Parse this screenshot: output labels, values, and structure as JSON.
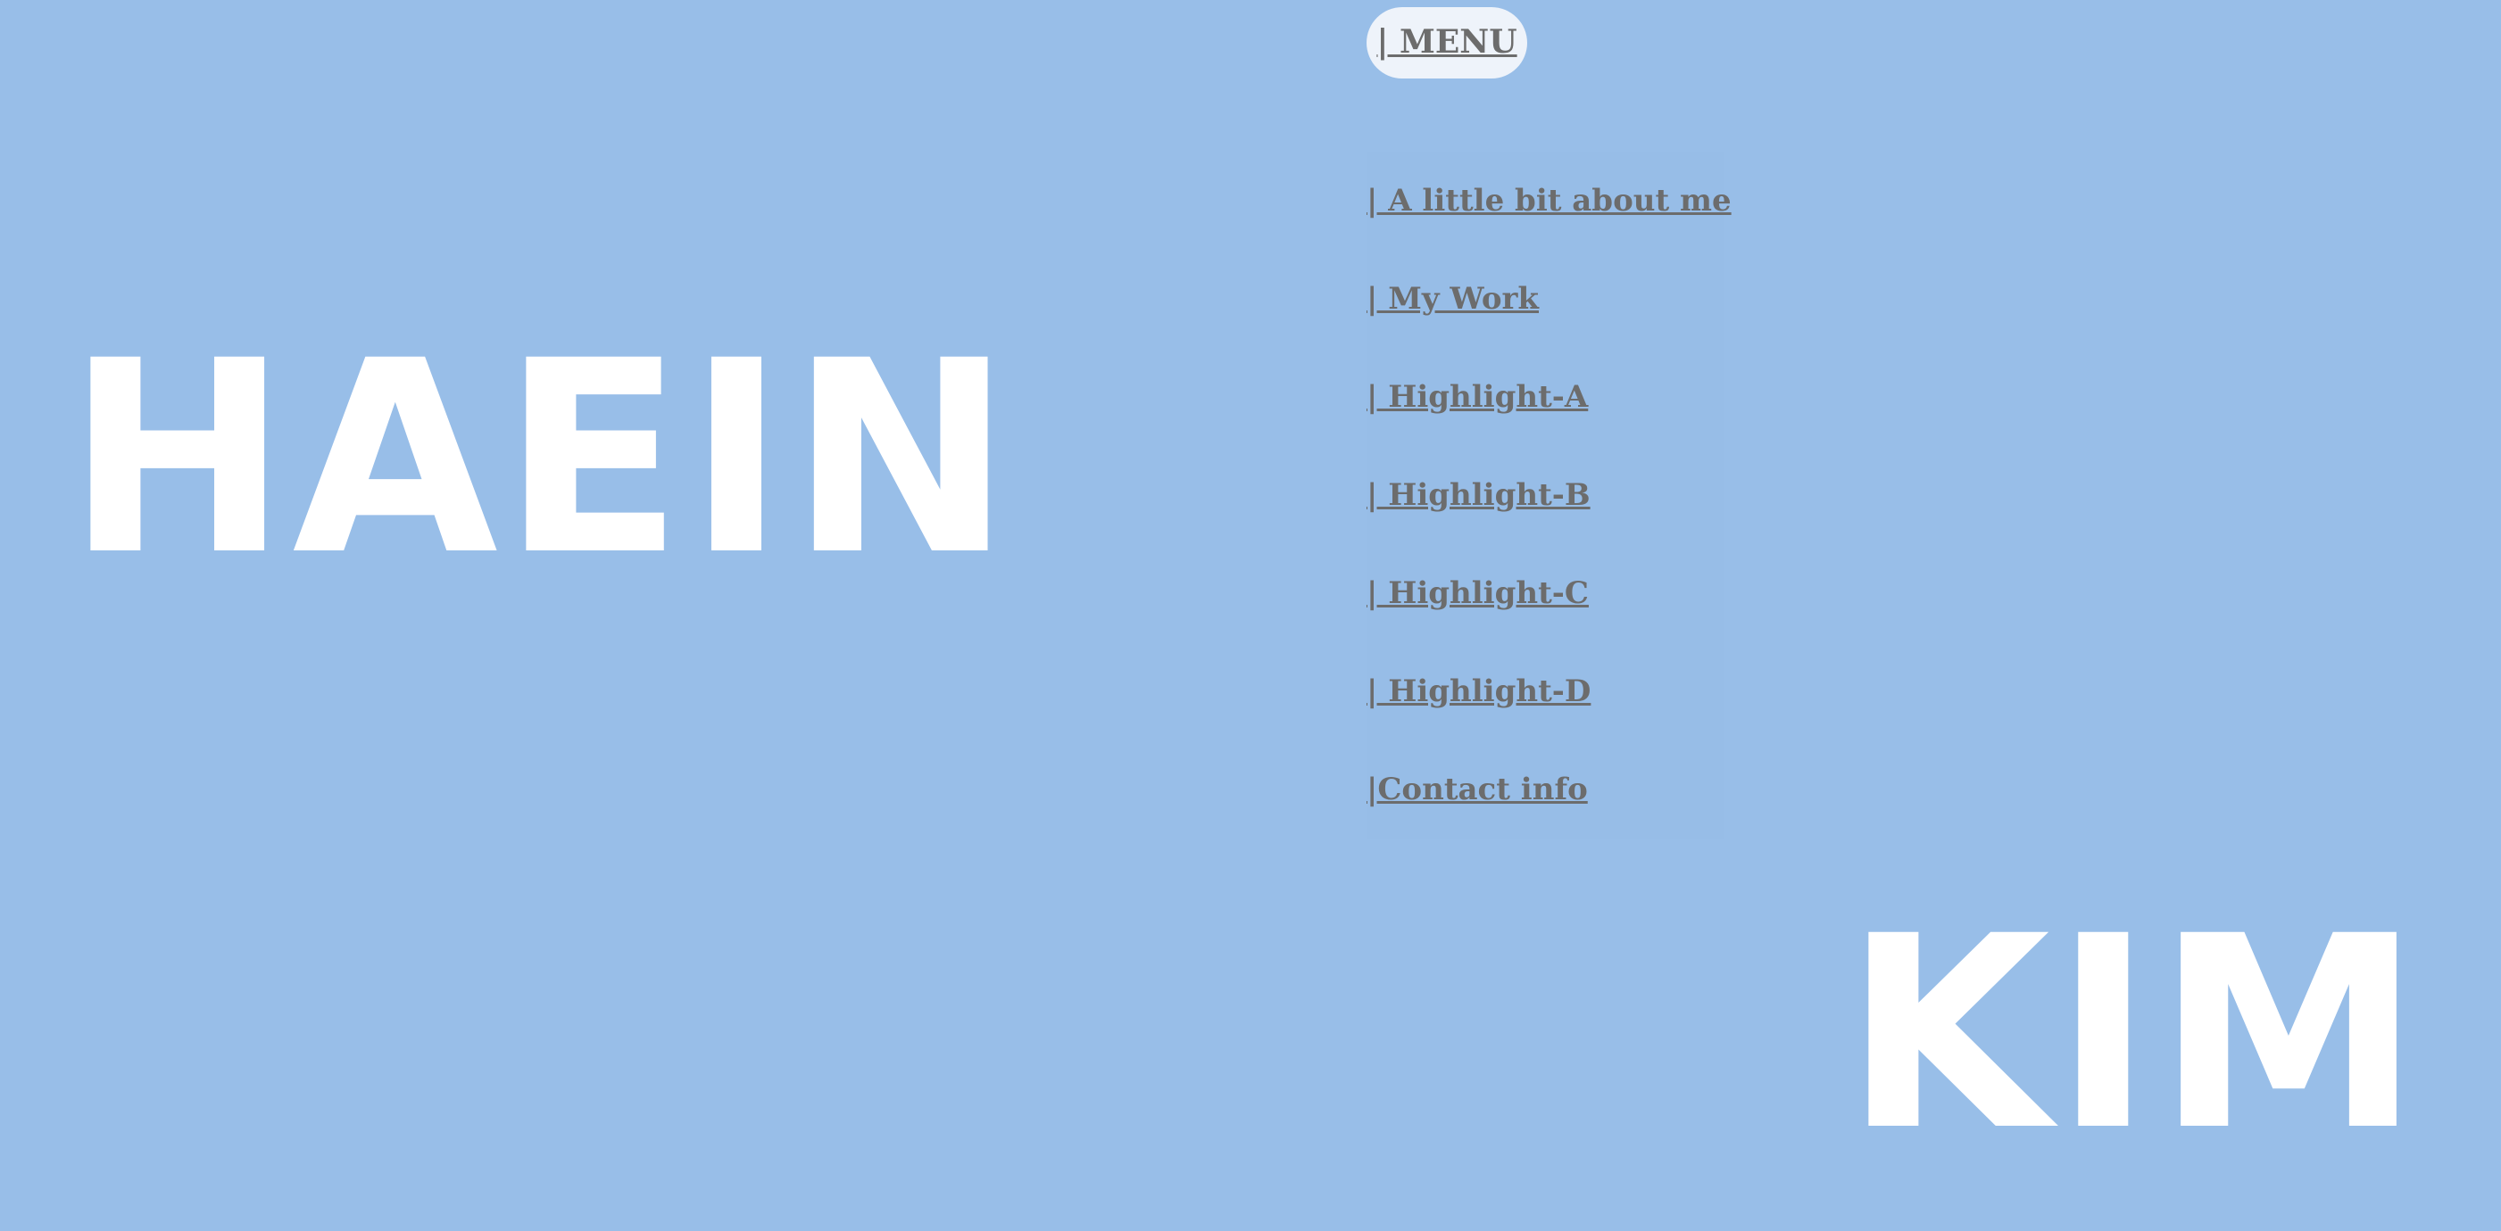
{
  "hero": {
    "first_name": "HAEIN",
    "last_name": "KIM"
  },
  "menu": {
    "button_label": "| MENU",
    "items": [
      {
        "label": "| A little bit about me"
      },
      {
        "label": "| My Work"
      },
      {
        "label": "| Highlight-A"
      },
      {
        "label": "| Highlight-B"
      },
      {
        "label": "| Highlight-C"
      },
      {
        "label": "| Highlight-D"
      },
      {
        "label": "|Contact info"
      }
    ]
  },
  "colors": {
    "background": "#98bee8",
    "text_white": "#ffffff",
    "link_gray": "#6c6c6c",
    "menu_button_bg": "#eef3fa"
  }
}
